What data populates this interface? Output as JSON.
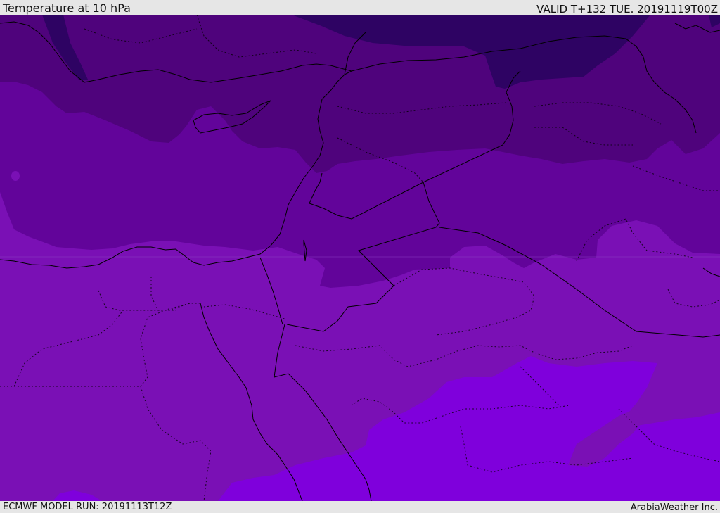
{
  "header": {
    "title": "Temperature at 10 hPa",
    "valid": "VALID T+132 TUE. 20191119T00Z"
  },
  "footer": {
    "model_run": "ECMWF MODEL RUN: 20191113T12Z",
    "credit": "ArabiaWeather Inc."
  },
  "colors": {
    "band_darkest": "#2e0363",
    "band_dark": "#4f037c",
    "band_mid": "#62049a",
    "band_light": "#7a10b5",
    "band_bright": "#7f00dc",
    "border_line": "#000000",
    "chrome": "#e6e6e6"
  }
}
